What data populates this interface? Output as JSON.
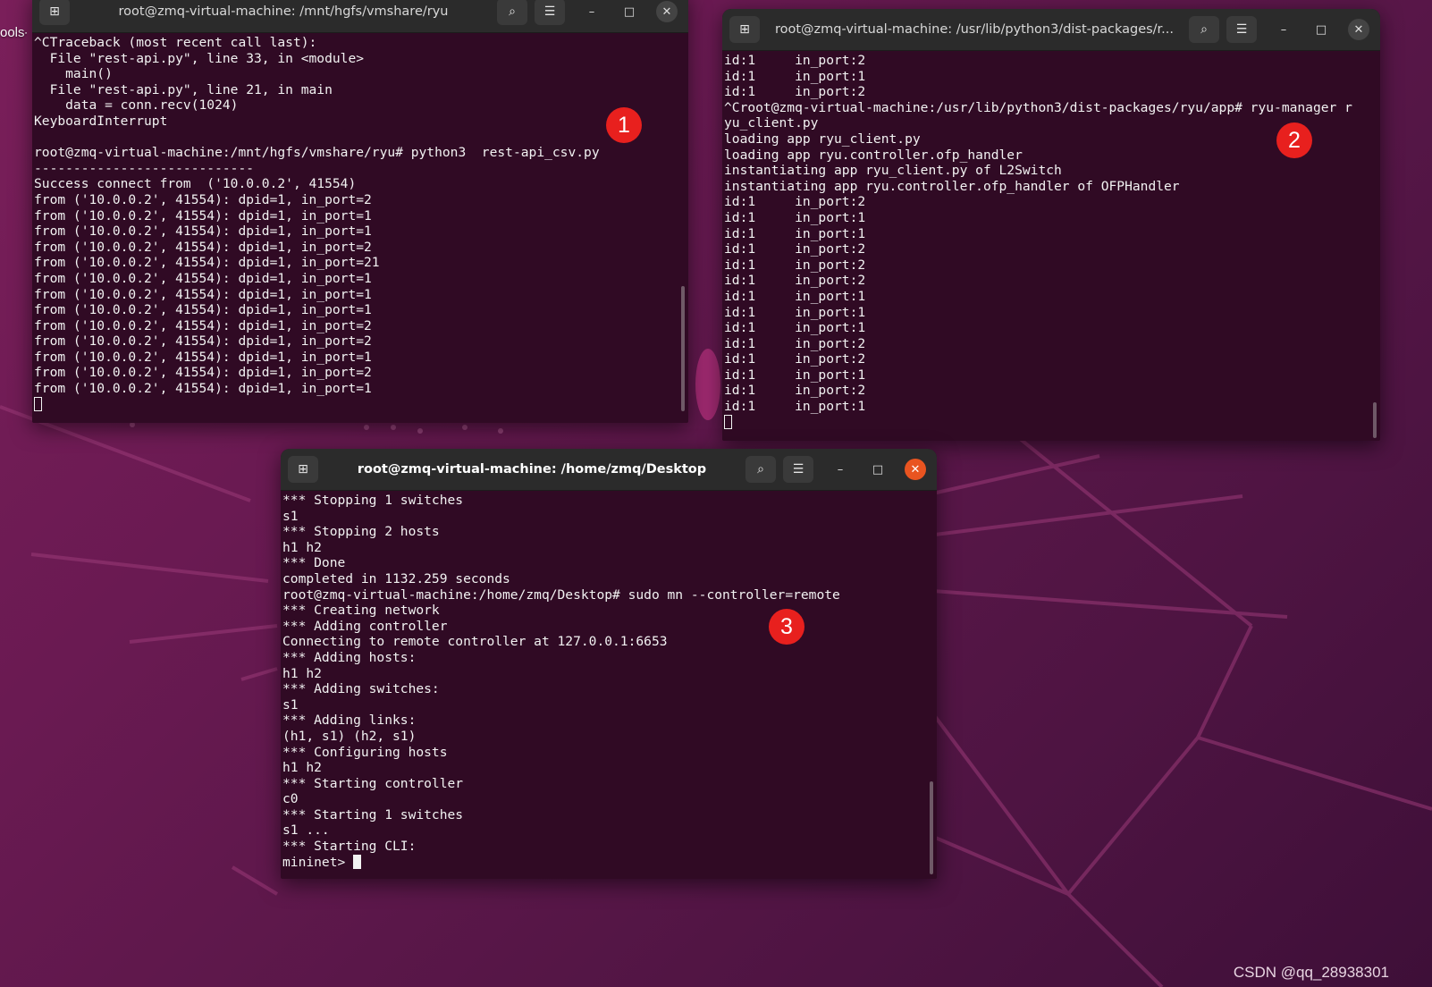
{
  "desktop": {
    "icon_label": "ools-\np",
    "watermark": "CSDN @qq_28938301"
  },
  "terminal1": {
    "title": "root@zmq-virtual-machine: /mnt/hgfs/vmshare/ryu",
    "lines": [
      "^CTraceback (most recent call last):",
      "  File \"rest-api.py\", line 33, in <module>",
      "    main()",
      "  File \"rest-api.py\", line 21, in main",
      "    data = conn.recv(1024)",
      "KeyboardInterrupt",
      "",
      "root@zmq-virtual-machine:/mnt/hgfs/vmshare/ryu# python3  rest-api_csv.py",
      "----------------------------",
      "Success connect from  ('10.0.0.2', 41554)",
      "from ('10.0.0.2', 41554): dpid=1, in_port=2",
      "from ('10.0.0.2', 41554): dpid=1, in_port=1",
      "from ('10.0.0.2', 41554): dpid=1, in_port=1",
      "from ('10.0.0.2', 41554): dpid=1, in_port=2",
      "from ('10.0.0.2', 41554): dpid=1, in_port=21",
      "from ('10.0.0.2', 41554): dpid=1, in_port=1",
      "from ('10.0.0.2', 41554): dpid=1, in_port=1",
      "from ('10.0.0.2', 41554): dpid=1, in_port=1",
      "from ('10.0.0.2', 41554): dpid=1, in_port=2",
      "from ('10.0.0.2', 41554): dpid=1, in_port=2",
      "from ('10.0.0.2', 41554): dpid=1, in_port=1",
      "from ('10.0.0.2', 41554): dpid=1, in_port=2",
      "from ('10.0.0.2', 41554): dpid=1, in_port=1"
    ],
    "marker": "1"
  },
  "terminal2": {
    "title": "root@zmq-virtual-machine: /usr/lib/python3/dist-packages/r...",
    "lines": [
      "id:1     in_port:2",
      "id:1     in_port:1",
      "id:1     in_port:2",
      "^Croot@zmq-virtual-machine:/usr/lib/python3/dist-packages/ryu/app# ryu-manager r",
      "yu_client.py",
      "loading app ryu_client.py",
      "loading app ryu.controller.ofp_handler",
      "instantiating app ryu_client.py of L2Switch",
      "instantiating app ryu.controller.ofp_handler of OFPHandler",
      "id:1     in_port:2",
      "id:1     in_port:1",
      "id:1     in_port:1",
      "id:1     in_port:2",
      "id:1     in_port:2",
      "id:1     in_port:2",
      "id:1     in_port:1",
      "id:1     in_port:1",
      "id:1     in_port:1",
      "id:1     in_port:2",
      "id:1     in_port:2",
      "id:1     in_port:1",
      "id:1     in_port:2",
      "id:1     in_port:1"
    ],
    "marker": "2"
  },
  "terminal3": {
    "title": "root@zmq-virtual-machine: /home/zmq/Desktop",
    "lines": [
      "*** Stopping 1 switches",
      "s1",
      "*** Stopping 2 hosts",
      "h1 h2",
      "*** Done",
      "completed in 1132.259 seconds",
      "root@zmq-virtual-machine:/home/zmq/Desktop# sudo mn --controller=remote",
      "*** Creating network",
      "*** Adding controller",
      "Connecting to remote controller at 127.0.0.1:6653",
      "*** Adding hosts:",
      "h1 h2",
      "*** Adding switches:",
      "s1",
      "*** Adding links:",
      "(h1, s1) (h2, s1)",
      "*** Configuring hosts",
      "h1 h2",
      "*** Starting controller",
      "c0",
      "*** Starting 1 switches",
      "s1 ...",
      "*** Starting CLI:"
    ],
    "prompt": "mininet> ",
    "marker": "3"
  }
}
